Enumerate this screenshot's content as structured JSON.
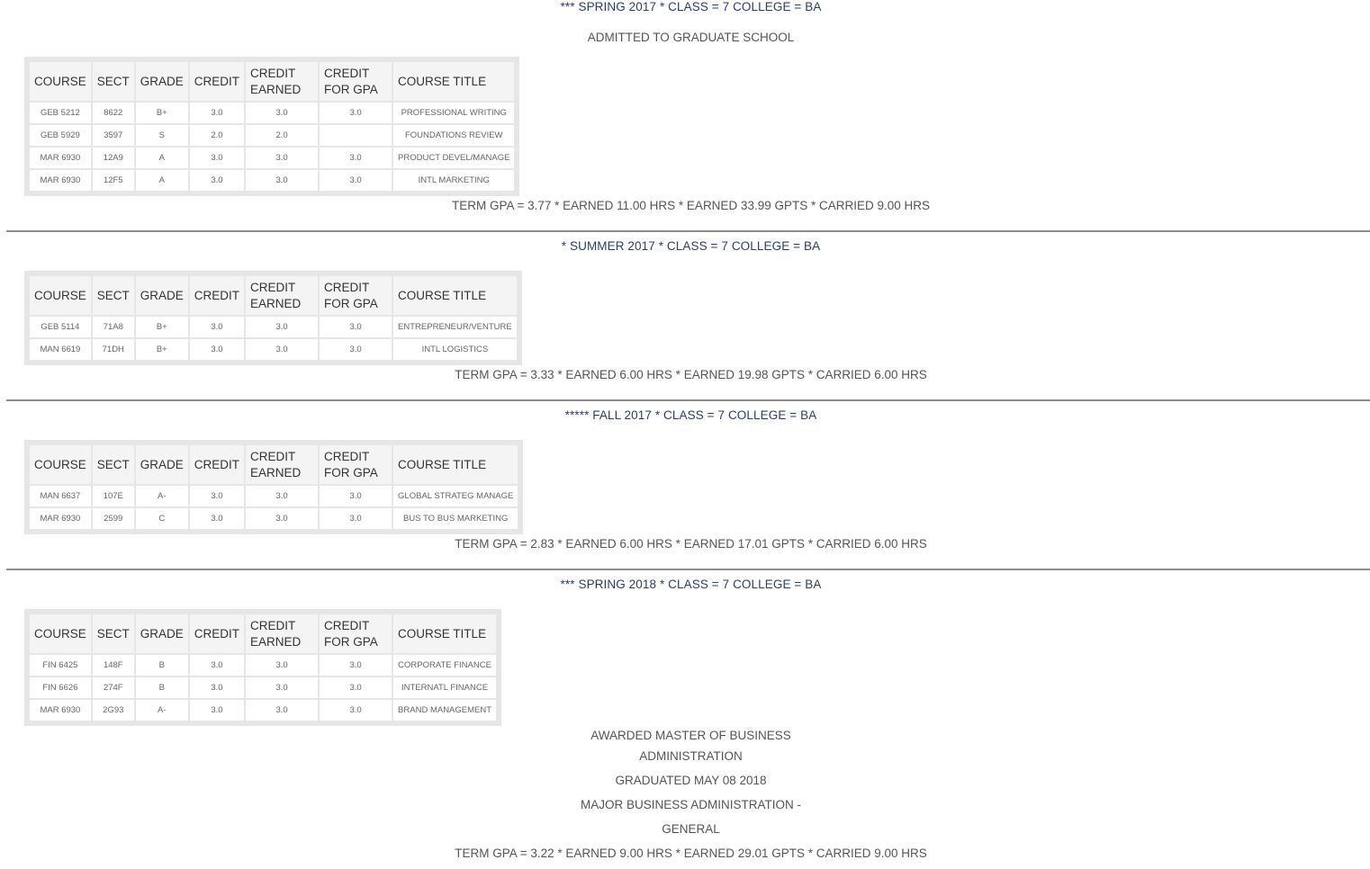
{
  "headers": [
    "COURSE",
    "SECT",
    "GRADE",
    "CREDIT",
    "CREDIT EARNED",
    "CREDIT FOR GPA",
    "COURSE TITLE"
  ],
  "terms": [
    {
      "heading": "*** SPRING 2017 * CLASS = 7 COLLEGE = BA",
      "notes_before": [
        "ADMITTED TO GRADUATE SCHOOL"
      ],
      "rows": [
        [
          "GEB 5212",
          "8622",
          "B+",
          "3.0",
          "3.0",
          "3.0",
          "PROFESSIONAL WRITING"
        ],
        [
          "GEB 5929",
          "3597",
          "S",
          "2.0",
          "2.0",
          "",
          "FOUNDATIONS REVIEW"
        ],
        [
          "MAR 6930",
          "12A9",
          "A",
          "3.0",
          "3.0",
          "3.0",
          "PRODUCT DEVEL/MANAGE"
        ],
        [
          "MAR 6930",
          "12F5",
          "A",
          "3.0",
          "3.0",
          "3.0",
          "INTL MARKETING"
        ]
      ],
      "notes_after": [],
      "summary": "TERM GPA = 3.77 * EARNED 11.00 HRS * EARNED 33.99 GPTS * CARRIED 9.00 HRS"
    },
    {
      "heading": "* SUMMER 2017 * CLASS = 7 COLLEGE = BA",
      "notes_before": [],
      "rows": [
        [
          "GEB 5114",
          "71A8",
          "B+",
          "3.0",
          "3.0",
          "3.0",
          "ENTREPRENEUR/VENTURE"
        ],
        [
          "MAN 6619",
          "71DH",
          "B+",
          "3.0",
          "3.0",
          "3.0",
          "INTL LOGISTICS"
        ]
      ],
      "notes_after": [],
      "summary": "TERM GPA = 3.33 * EARNED 6.00 HRS * EARNED 19.98 GPTS * CARRIED 6.00 HRS"
    },
    {
      "heading": "***** FALL 2017 * CLASS = 7 COLLEGE = BA",
      "notes_before": [],
      "rows": [
        [
          "MAN 6637",
          "107E",
          "A-",
          "3.0",
          "3.0",
          "3.0",
          "GLOBAL STRATEG MANAGE"
        ],
        [
          "MAR 6930",
          "2599",
          "C",
          "3.0",
          "3.0",
          "3.0",
          "BUS TO BUS MARKETING"
        ]
      ],
      "notes_after": [],
      "summary": "TERM GPA = 2.83 * EARNED 6.00 HRS * EARNED 17.01 GPTS * CARRIED 6.00 HRS"
    },
    {
      "heading": "*** SPRING 2018 * CLASS = 7 COLLEGE = BA",
      "notes_before": [],
      "rows": [
        [
          "FIN 6425",
          "148F",
          "B",
          "3.0",
          "3.0",
          "3.0",
          "CORPORATE FINANCE"
        ],
        [
          "FIN 6626",
          "274F",
          "B",
          "3.0",
          "3.0",
          "3.0",
          "INTERNATL FINANCE"
        ],
        [
          "MAR 6930",
          "2G93",
          "A-",
          "3.0",
          "3.0",
          "3.0",
          "BRAND MANAGEMENT"
        ]
      ],
      "notes_after": [
        "AWARDED MASTER OF BUSINESS",
        "ADMINISTRATION",
        "GRADUATED MAY 08 2018",
        "MAJOR BUSINESS ADMINISTRATION -",
        "GENERAL"
      ],
      "summary": "TERM GPA = 3.22 * EARNED 9.00 HRS * EARNED 29.01 GPTS * CARRIED 9.00 HRS"
    }
  ]
}
